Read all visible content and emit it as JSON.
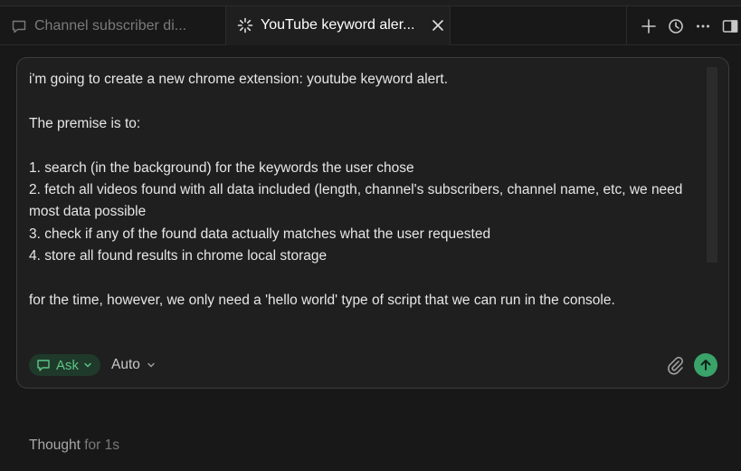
{
  "tabs": [
    {
      "label": "Channel subscriber di...",
      "icon": "chat-bubble-icon",
      "active": false
    },
    {
      "label": "YouTube keyword aler...",
      "icon": "loading-spinner-icon",
      "active": true,
      "close_icon": "close-icon"
    }
  ],
  "tab_actions": [
    "plus-icon",
    "history-clock-icon",
    "more-ellipsis-icon",
    "toggle-panel-icon"
  ],
  "composer": {
    "lines": [
      "i'm going to create a new chrome extension: youtube keyword alert.",
      "",
      "The premise is to:",
      "",
      "1. search (in the background) for the keywords the user chose",
      "2. fetch all videos found with all data included (length, channel's subscribers, channel name, etc, we need most data possible",
      "3. check if any of the found data actually matches what the user requested",
      "4. store all found results in chrome local storage",
      "",
      "for the time, however, we only need a 'hello world' type of script that we can run in the console."
    ],
    "mode_label": "Ask",
    "model_label": "Auto"
  },
  "status": {
    "thought_label": "Thought",
    "thought_duration": "for 1s"
  },
  "colors": {
    "background": "#181818",
    "accent_green": "#3aa36a",
    "ask_pill_bg": "#1f3a2a",
    "ask_pill_text": "#5fc588"
  }
}
